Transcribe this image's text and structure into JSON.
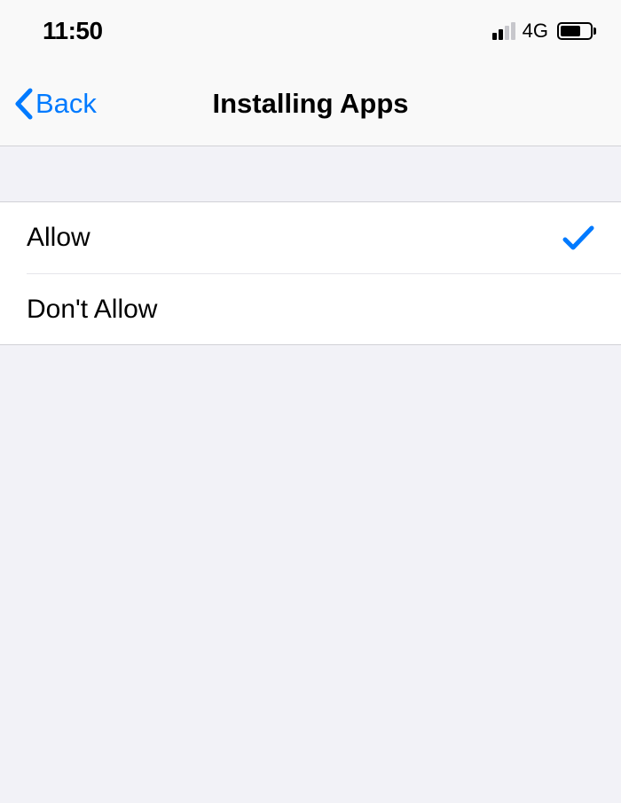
{
  "status": {
    "time": "11:50",
    "network": "4G"
  },
  "nav": {
    "back": "Back",
    "title": "Installing Apps"
  },
  "options": {
    "allow": {
      "label": "Allow",
      "selected": true
    },
    "dont_allow": {
      "label": "Don't Allow",
      "selected": false
    }
  },
  "colors": {
    "tint": "#007aff"
  }
}
